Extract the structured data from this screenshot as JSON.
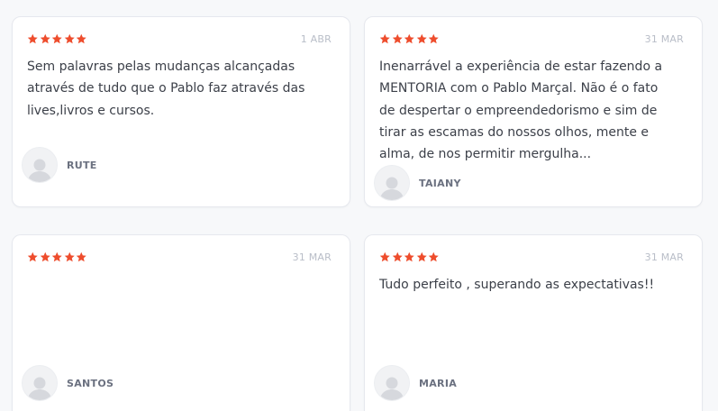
{
  "colors": {
    "star": "#ee4d2d",
    "date": "#b9bec8",
    "text": "#3c4049",
    "name": "#6b7180"
  },
  "reviews": [
    {
      "rating": 5,
      "date": "1 ABR",
      "text": "Sem palavras pelas mudanças alcançadas através de tudo que o Pablo faz através das lives,livros e cursos.",
      "author": "RUTE"
    },
    {
      "rating": 5,
      "date": "31 MAR",
      "text": "Inenarrável a experiência de estar fazendo a MENTORIA com o Pablo Marçal. Não é o fato de despertar o empreendedorismo e sim de tirar as escamas do nossos olhos, mente e alma, de nos permitir mergulha...",
      "author": "TAIANY"
    },
    {
      "rating": 5,
      "date": "31 MAR",
      "text": "",
      "author": "SANTOS"
    },
    {
      "rating": 5,
      "date": "31 MAR",
      "text": "Tudo perfeito , superando as expectativas!!",
      "author": "MARIA"
    }
  ]
}
